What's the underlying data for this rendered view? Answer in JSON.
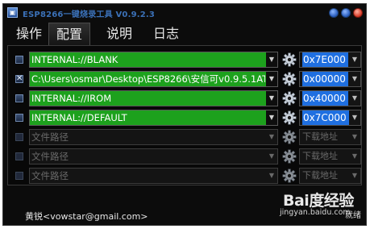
{
  "window": {
    "title": "ESP8266一键烧录工具 V0.9.2.3",
    "icon_glyph": "▣"
  },
  "tabs": [
    {
      "label": "操作",
      "active": false
    },
    {
      "label": "配置",
      "active": true
    },
    {
      "label": "说明",
      "active": false
    },
    {
      "label": "日志",
      "active": false
    }
  ],
  "rows": [
    {
      "checked": false,
      "enabled": true,
      "path": "INTERNAL://BLANK",
      "address": "0x7E000"
    },
    {
      "checked": true,
      "enabled": true,
      "path": "C:\\Users\\osmar\\Desktop\\ESP8266\\安信可v0.9.5.1AT",
      "address": "0x00000"
    },
    {
      "checked": false,
      "enabled": true,
      "path": "INTERNAL://IROM",
      "address": "0x40000"
    },
    {
      "checked": false,
      "enabled": true,
      "path": "INTERNAL://DEFAULT",
      "address": "0x7C000"
    },
    {
      "checked": false,
      "enabled": false,
      "path_placeholder": "文件路径",
      "address_placeholder": "下载地址"
    },
    {
      "checked": false,
      "enabled": false,
      "path_placeholder": "文件路径",
      "address_placeholder": "下载地址"
    },
    {
      "checked": false,
      "enabled": false,
      "path_placeholder": "文件路径",
      "address_placeholder": "下载地址"
    }
  ],
  "glyphs": {
    "dropdown": "▼",
    "check": "✕"
  },
  "status": {
    "author": "黄锐<vowstar@gmail.com>",
    "state": "就绪"
  },
  "watermark": {
    "logo": "Bai度经验",
    "url": "jingyan.baidu.com"
  },
  "colors": {
    "window_bg": "#0c0c0c",
    "path_fill": "#1da11d",
    "address_highlight": "#1f6fe0",
    "title_text": "#3b71b8"
  },
  "icons": [
    "app-icon",
    "minimize-icon",
    "maximize-icon",
    "close-icon",
    "gear-icon",
    "chevron-down-icon",
    "checkbox"
  ]
}
